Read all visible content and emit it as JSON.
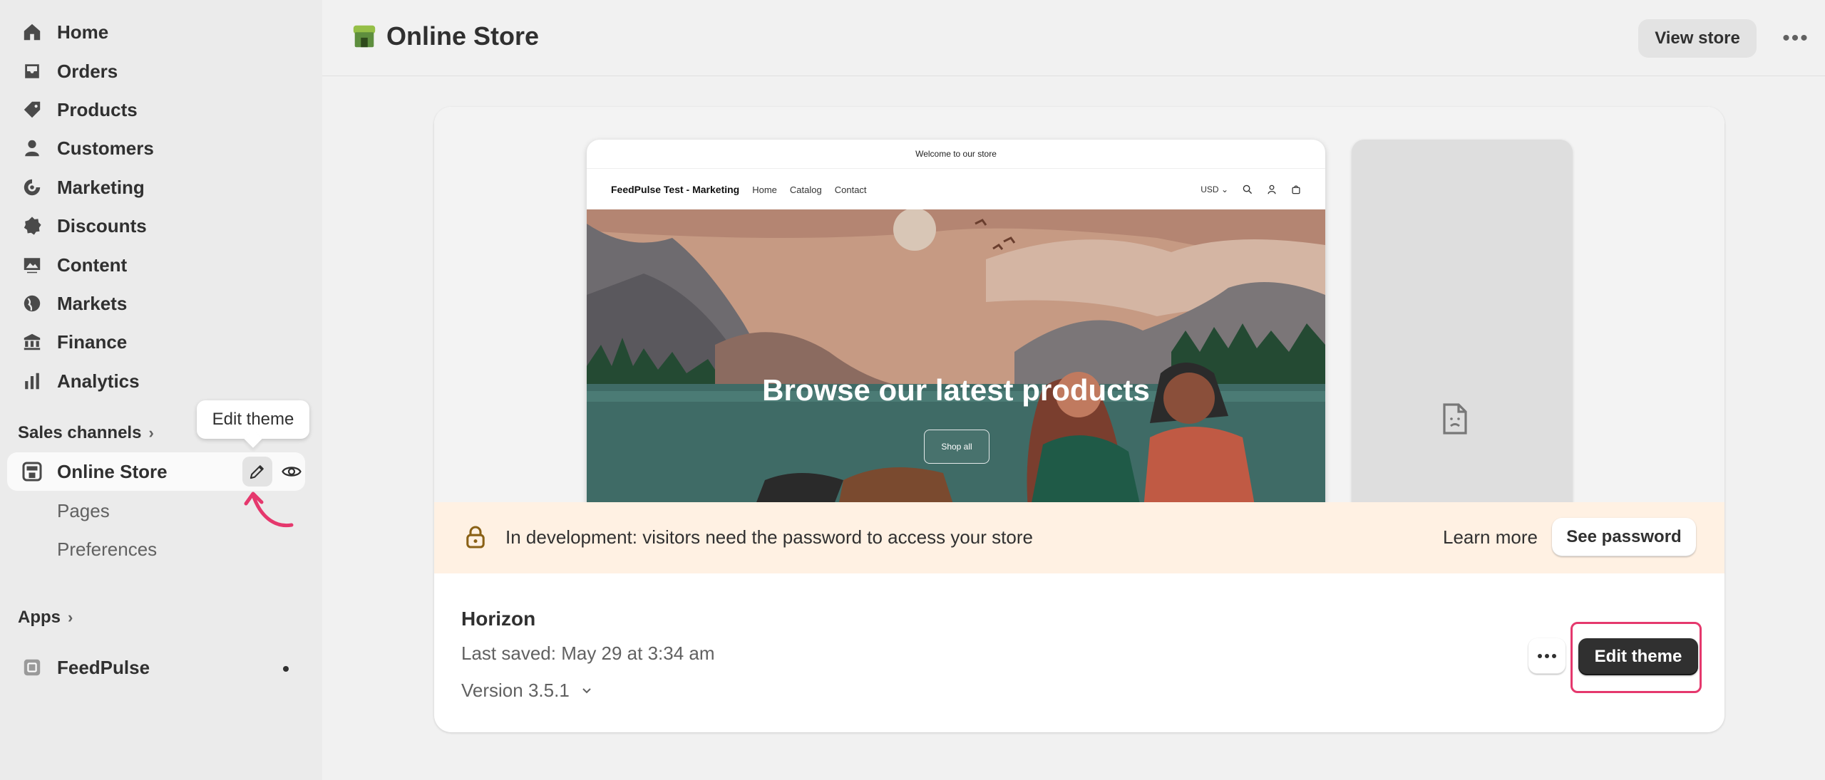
{
  "sidebar": {
    "nav": [
      {
        "label": "Home",
        "icon": "home-icon"
      },
      {
        "label": "Orders",
        "icon": "inbox-icon"
      },
      {
        "label": "Products",
        "icon": "tag-icon"
      },
      {
        "label": "Customers",
        "icon": "person-icon"
      },
      {
        "label": "Marketing",
        "icon": "target-icon"
      },
      {
        "label": "Discounts",
        "icon": "discount-icon"
      },
      {
        "label": "Content",
        "icon": "image-icon"
      },
      {
        "label": "Markets",
        "icon": "globe-icon"
      },
      {
        "label": "Finance",
        "icon": "bank-icon"
      },
      {
        "label": "Analytics",
        "icon": "bar-chart-icon"
      }
    ],
    "sales_channels_label": "Sales channels",
    "online_store_label": "Online Store",
    "tooltip": "Edit theme",
    "sub_items": [
      "Pages",
      "Preferences"
    ],
    "apps_label": "Apps",
    "feedpulse_label": "FeedPulse"
  },
  "header": {
    "title": "Online Store",
    "view_store_label": "View store"
  },
  "preview": {
    "announcement": "Welcome to our store",
    "brand": "FeedPulse Test - Marketing",
    "links": [
      "Home",
      "Catalog",
      "Contact"
    ],
    "currency": "USD",
    "hero_title": "Browse our latest products",
    "shop_all": "Shop all"
  },
  "dev_banner": {
    "message": "In development: visitors need the password to access your store",
    "learn_more": "Learn more",
    "see_password": "See password"
  },
  "theme": {
    "name": "Horizon",
    "last_saved": "Last saved: May 29 at 3:34 am",
    "version": "Version 3.5.1",
    "edit_label": "Edit theme"
  },
  "colors": {
    "accent_highlight": "#e5386d",
    "primary_button": "#303030",
    "banner_bg": "#fff1e3"
  }
}
